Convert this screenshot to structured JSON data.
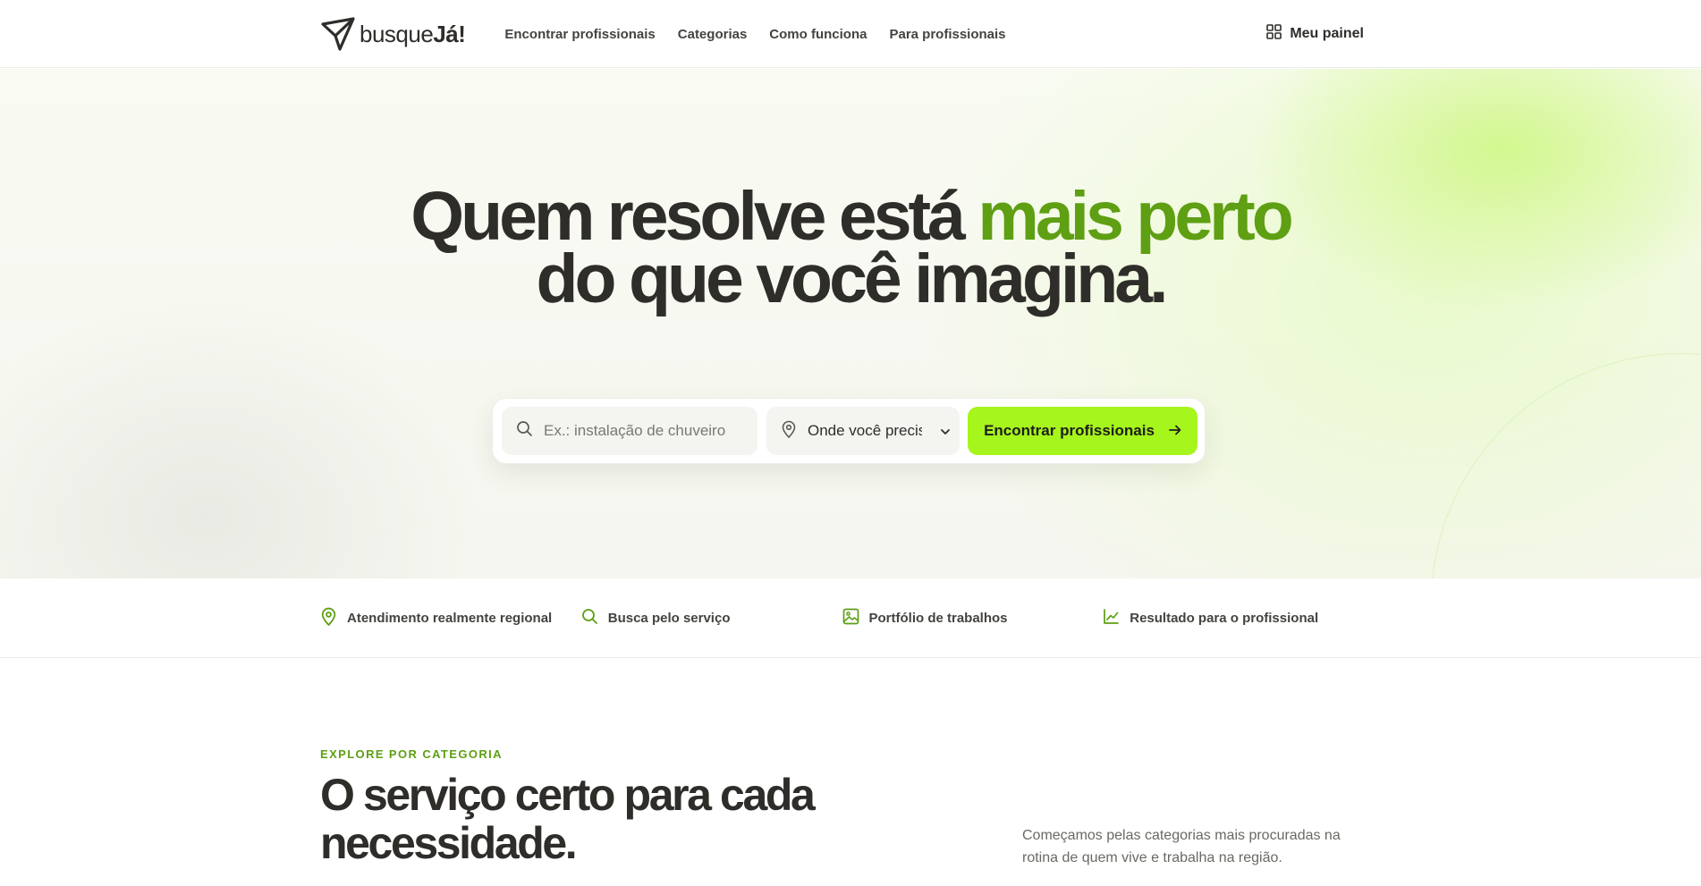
{
  "header": {
    "logo": {
      "prefix": "busque",
      "suffix": "Já!"
    },
    "nav": [
      {
        "label": "Encontrar profissionais"
      },
      {
        "label": "Categorias"
      },
      {
        "label": "Como funciona"
      },
      {
        "label": "Para profissionais"
      }
    ],
    "panel_label": "Meu painel"
  },
  "hero": {
    "title_part1": "Quem resolve está ",
    "title_accent": "mais perto",
    "title_part2": " do que você imagina.",
    "search_placeholder": "Ex.: instalação de chuveiro",
    "location_value": "Onde você precis",
    "cta_label": "Encontrar profissionais"
  },
  "features": [
    {
      "label": "Atendimento realmente regional",
      "icon": "map-pin-icon"
    },
    {
      "label": "Busca pelo serviço",
      "icon": "search-icon"
    },
    {
      "label": "Portfólio de trabalhos",
      "icon": "image-icon"
    },
    {
      "label": "Resultado para o profissional",
      "icon": "line-chart-icon"
    }
  ],
  "categories_section": {
    "eyebrow": "EXPLORE POR CATEGORIA",
    "title": "O serviço certo para cada necessidade.",
    "description": "Começamos pelas categorias mais procuradas na rotina de quem vive e trabalha na região."
  },
  "colors": {
    "accent_green": "#5e9f13",
    "cta_lime": "#a6f51d",
    "text_dark": "#2f2d2a"
  }
}
